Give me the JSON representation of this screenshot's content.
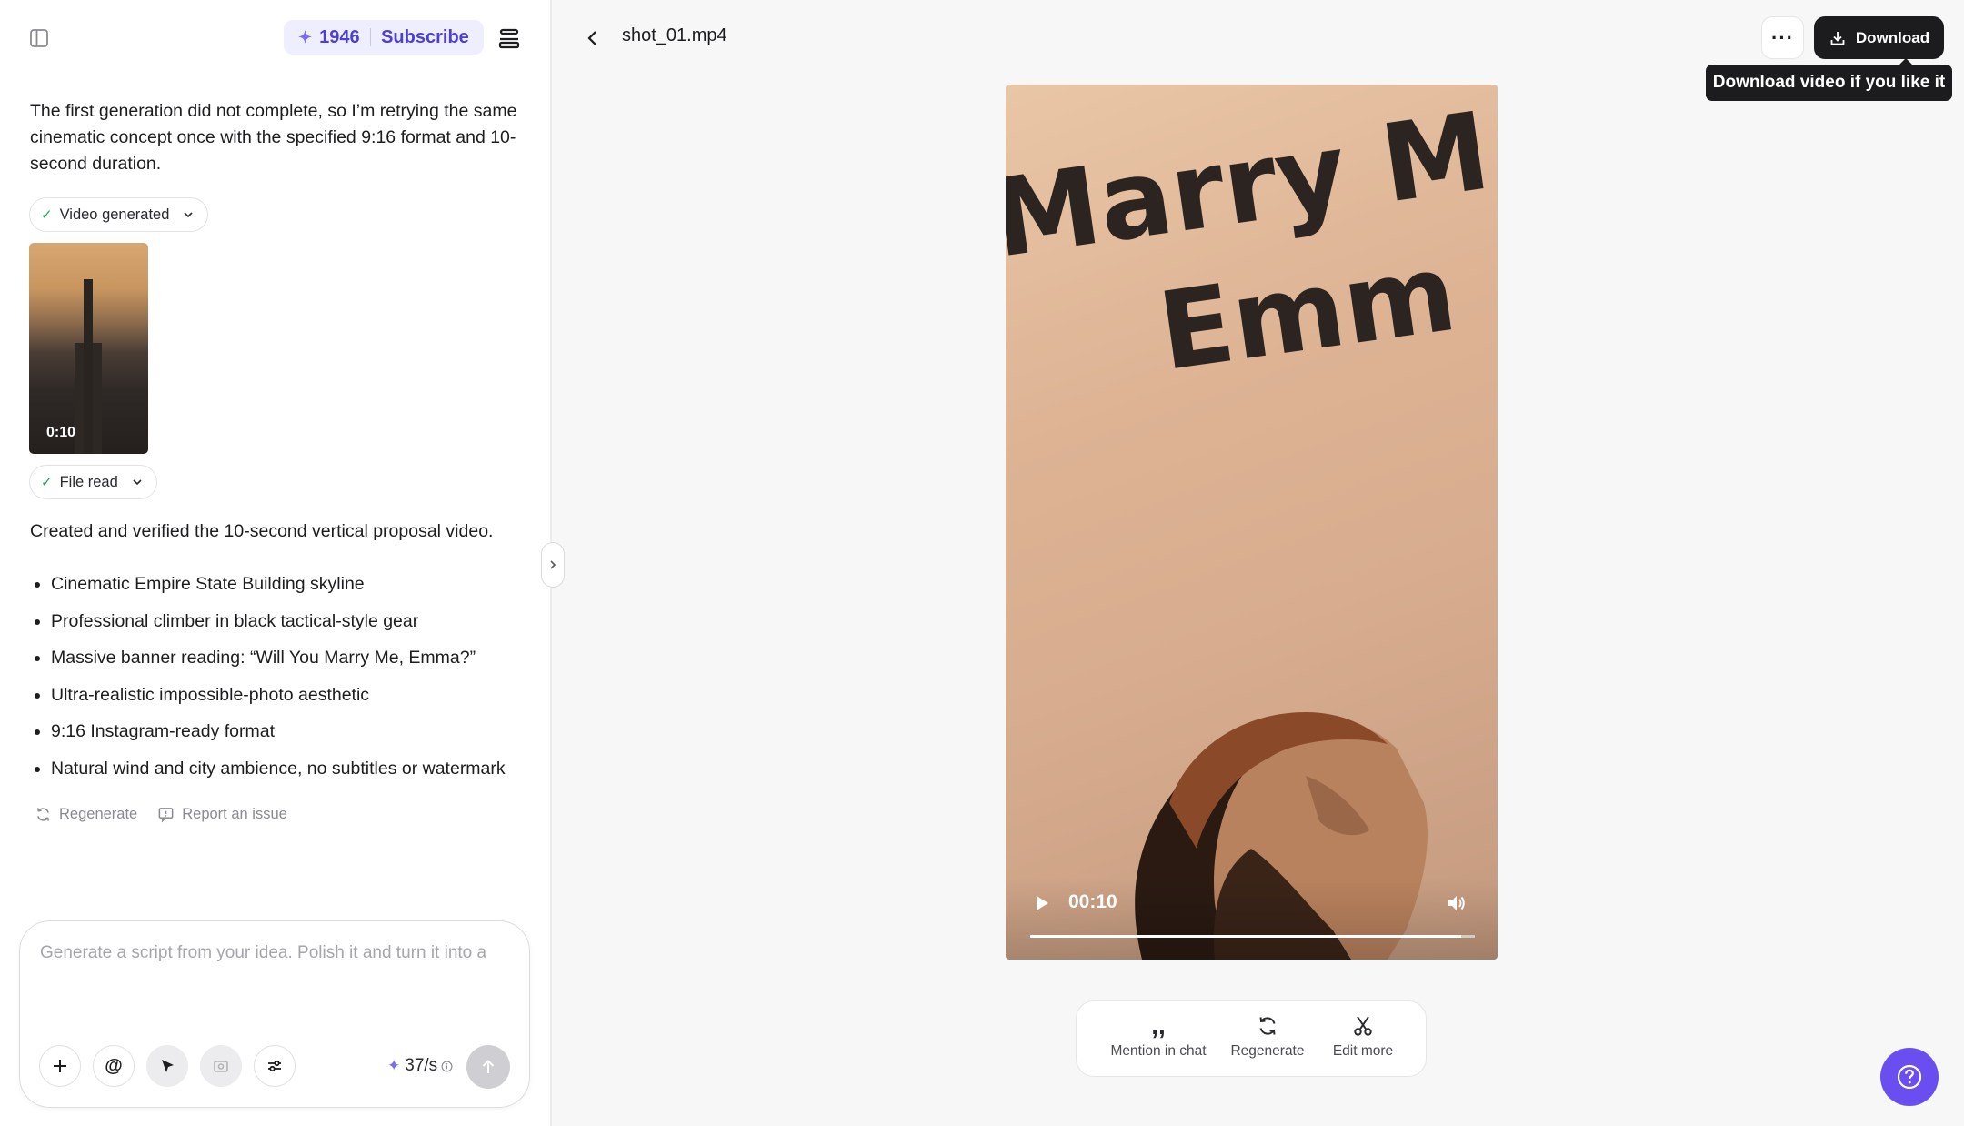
{
  "header": {
    "credits": "1946",
    "subscribe_label": "Subscribe"
  },
  "chat": {
    "intro_text": "The first generation did not complete, so I’m retrying the same cinematic concept once with the specified 9:16 format and 10-second duration.",
    "chip_video": "Video generated",
    "thumb_duration": "0:10",
    "chip_file": "File read",
    "summary_text": "Created and verified the 10-second vertical proposal video.",
    "bullets": [
      "Cinematic Empire State Building skyline",
      "Professional climber in black tactical-style gear",
      "Massive banner reading: “Will You Marry Me, Emma?”",
      "Ultra-realistic impossible-photo aesthetic",
      "9:16 Instagram-ready format",
      "Natural wind and city ambience, no subtitles or watermark"
    ],
    "regenerate_label": "Regenerate",
    "report_label": "Report an issue"
  },
  "composer": {
    "placeholder": "Generate a script from your idea. Polish it and turn it into a",
    "rate": "37/s"
  },
  "viewer": {
    "file_name": "shot_01.mp4",
    "download_label": "Download",
    "tooltip": "Download video if you like it",
    "banner_line1": "Marry M",
    "banner_line2": "Emm",
    "time": "00:10",
    "progress": 0.97,
    "toolbar": {
      "mention": "Mention in chat",
      "regenerate": "Regenerate",
      "edit": "Edit more"
    }
  },
  "colors": {
    "accent": "#4b3fd6",
    "help_button": "#6b4ef0",
    "dark_button": "#1c1c1e"
  },
  "icons": [
    "sidebar-toggle-icon",
    "sparkle-icon",
    "stack-menu-icon",
    "check-icon",
    "chevron-down-icon",
    "regenerate-icon",
    "report-icon",
    "plus-icon",
    "at-icon",
    "pointer-icon",
    "camera-icon",
    "sliders-icon",
    "info-icon",
    "send-arrow-icon",
    "chevron-right-icon",
    "chevron-left-icon",
    "more-icon",
    "download-icon",
    "play-icon",
    "volume-icon",
    "quote-icon",
    "refresh-icon",
    "scissors-icon",
    "help-icon"
  ]
}
